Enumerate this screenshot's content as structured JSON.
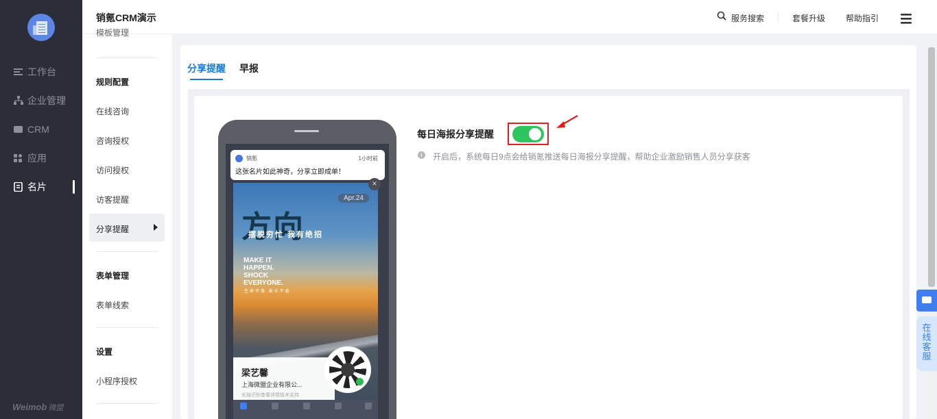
{
  "sidebar": {
    "items": [
      {
        "label": "工作台",
        "icon": "workbench-icon"
      },
      {
        "label": "企业管理",
        "icon": "org-chart-icon"
      },
      {
        "label": "CRM",
        "icon": "crm-icon"
      },
      {
        "label": "应用",
        "icon": "apps-grid-icon"
      },
      {
        "label": "名片",
        "icon": "business-card-icon"
      }
    ],
    "active_index": 4,
    "brand": "Weimob",
    "brand_cn": "微盟"
  },
  "header": {
    "title": "销氪CRM演示",
    "search_label": "服务搜索",
    "upgrade_label": "套餐升级",
    "help_label": "帮助指引",
    "menu_icon": "hamburger-menu-icon"
  },
  "subnav": {
    "partial_item": "模板管理",
    "section1": "规则配置",
    "items1": [
      "在线咨询",
      "咨询授权",
      "访问授权",
      "访客提醒",
      "分享提醒"
    ],
    "active_item": "分享提醒",
    "section2": "表单管理",
    "items2": [
      "表单线索"
    ],
    "section3": "设置",
    "items3": [
      "小程序授权"
    ]
  },
  "tabs": [
    {
      "label": "分享提醒",
      "active": true
    },
    {
      "label": "早报",
      "active": false
    }
  ],
  "phone_preview": {
    "notification": {
      "app": "销氪",
      "time": "1小时前",
      "message": "这张名片如此神奇，分享立即成单！"
    },
    "poster": {
      "date": "Apr.24",
      "headline": "方向",
      "tagline": "摆脱穷忙  我有绝招",
      "english_lines": [
        "MAKE IT",
        "HAPPEN.",
        "SHOCK",
        "EVERYONE."
      ],
      "small_text": "生命不息  奋斗不息"
    },
    "card": {
      "name": "梁艺馨",
      "company": "上海微盟企业有限公...",
      "tip": "长按识别查看详情技术支持"
    }
  },
  "setting": {
    "title": "每日海报分享提醒",
    "enabled": true,
    "description": "开启后，系统每日9点会给销氪推送每日海报分享提醒，帮助企业激励销售人员分享获客"
  },
  "float": {
    "chat_icon": "chat-bubble-icon",
    "online_service": "在线客服"
  },
  "colors": {
    "sidebar_bg": "#2b2d38",
    "accent": "#1a7ad8",
    "toggle_on": "#2dc55e",
    "highlight_red": "#e02020",
    "service_blue": "#3f7ef0"
  }
}
